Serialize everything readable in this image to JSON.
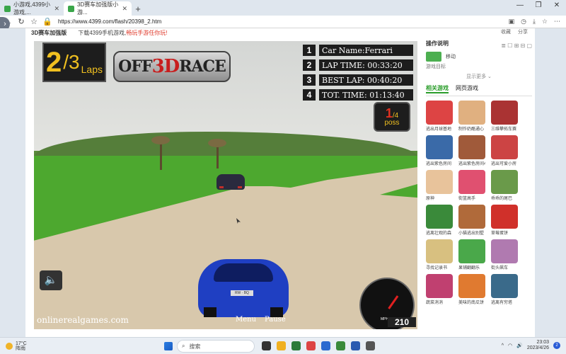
{
  "browser": {
    "tabs": [
      {
        "label": "小游戏,4399小游戏,...",
        "active": false
      },
      {
        "label": "3D赛车加强版小游...",
        "active": true
      }
    ],
    "url": "https://www.4399.com/flash/20398_2.htm",
    "new_tab": "+",
    "window_controls": [
      "—",
      "❐",
      "✕"
    ]
  },
  "page": {
    "breadcrumb": "3D赛车加强版",
    "download_text": "下载4399手机游戏,",
    "download_highlight": "畅玩手游任你玩!",
    "fav_buttons": [
      "收藏",
      "分享"
    ]
  },
  "game": {
    "laps_current": "2",
    "laps_total": "/3",
    "laps_label": "Laps",
    "logo_text": "OFF",
    "logo_3d": "3D",
    "logo_race": "RACE",
    "stats": [
      {
        "num": "1",
        "text": "Car Name:Ferrari"
      },
      {
        "num": "2",
        "text": "LAP TIME: 00:33:20"
      },
      {
        "num": "3",
        "text": "BEST LAP: 00:40:20"
      },
      {
        "num": "4",
        "text": "TOT. TIME: 01:13:40"
      }
    ],
    "position_current": "1",
    "position_total": "/4",
    "position_label": "poss",
    "site_text": "onlinerealgames.com",
    "menu_label": "Menu",
    "pause_label": "Pause",
    "speed": "210",
    "speed_unit": "MPH",
    "plate": "RW · BQ"
  },
  "panel": {
    "title": "操作说明",
    "move_label": "移动",
    "mouse_label": "游戏目标",
    "more_label": "显示更多 ⌄",
    "tabs": [
      "相关游戏",
      "网页游戏"
    ],
    "games": [
      {
        "name": "逃出月球基地",
        "color": "#d44"
      },
      {
        "name": "制作奶酪通心",
        "color": "#e0b080"
      },
      {
        "name": "三维攀拓车赛",
        "color": "#a33"
      },
      {
        "name": "逃出紫色房间",
        "color": "#3a6aa8"
      },
      {
        "name": "逃出紫色房间4",
        "color": "#a05a3a"
      },
      {
        "name": "逃出可爱小房",
        "color": "#c44"
      },
      {
        "name": "原神",
        "color": "#e8c39b"
      },
      {
        "name": "街篮高手",
        "color": "#e05070"
      },
      {
        "name": "乖乖的尾巴",
        "color": "#6a9a4a"
      },
      {
        "name": "逃离壮观的森",
        "color": "#3a8a3a"
      },
      {
        "name": "小猫逃出别墅",
        "color": "#b06a3a"
      },
      {
        "name": "草莓蛋饼",
        "color": "#d0302a"
      },
      {
        "name": "寻找记录书",
        "color": "#d8c080"
      },
      {
        "name": "果铺翻翻乐",
        "color": "#4aa84a"
      },
      {
        "name": "街头飙车",
        "color": "#b07ab0"
      },
      {
        "name": "蔬菜消消",
        "color": "#c04070"
      },
      {
        "name": "美味的南瓜饼",
        "color": "#e07a30"
      },
      {
        "name": "逃离有穷塔",
        "color": "#3a6a8a"
      }
    ],
    "tool_icons": "≣ ☐ ⊞ ⊟ ▢"
  },
  "taskbar": {
    "temp": "17°C",
    "weather": "阵雨",
    "search_placeholder": "搜索",
    "time": "23:03",
    "date": "2023/4/26",
    "badge": "2",
    "app_colors": [
      "#333",
      "#f0b020",
      "#2a7a3a",
      "#d44",
      "#2a6ad0",
      "#3a8a3a",
      "#2a5ab0",
      "#555"
    ]
  }
}
